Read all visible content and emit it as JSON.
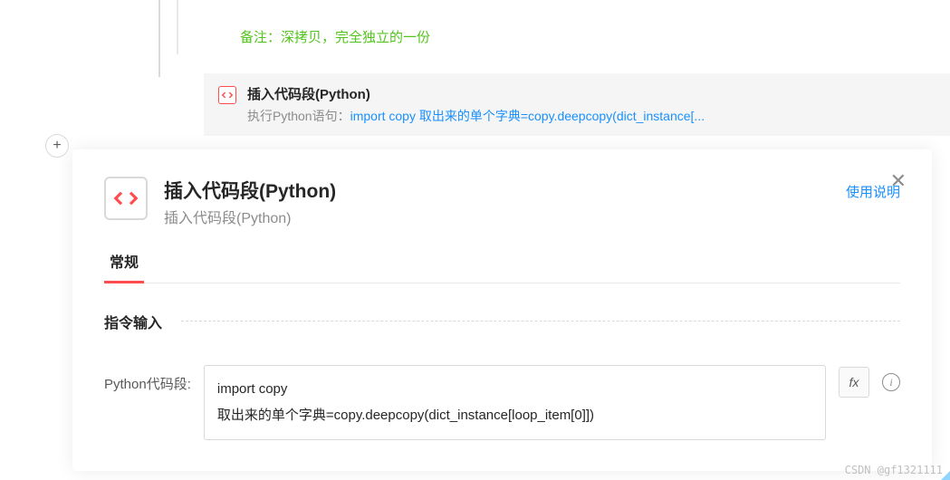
{
  "remark": "备注：深拷贝，完全独立的一份",
  "step": {
    "title": "插入代码段(Python)",
    "desc_prefix": "执行Python语句：",
    "desc_code": "import copy  取出来的单个字典=copy.deepcopy(dict_instance[..."
  },
  "modal": {
    "title": "插入代码段(Python)",
    "subtitle": "插入代码段(Python)",
    "usage_link": "使用说明",
    "tab_general": "常规",
    "section_label": "指令输入",
    "form_label": "Python代码段:",
    "code_line1": "import copy",
    "code_line2": "取出来的单个字典=copy.deepcopy(dict_instance[loop_item[0]])",
    "fx_label": "fx"
  },
  "watermark": "CSDN @gf1321111"
}
